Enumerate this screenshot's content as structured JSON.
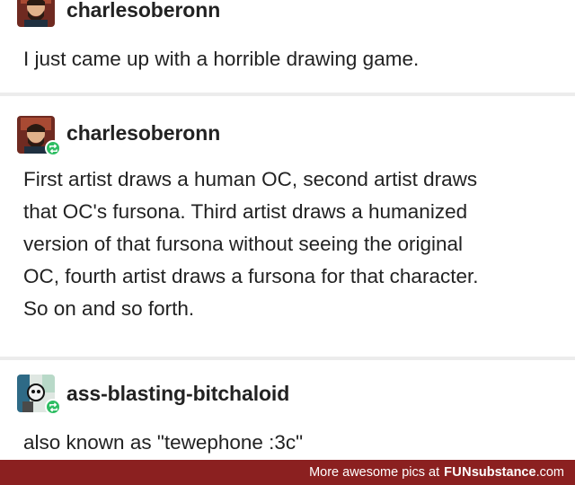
{
  "posts": [
    {
      "username": "charlesoberonn",
      "lines": [
        "I just came up with a horrible drawing game."
      ],
      "reblog": false
    },
    {
      "username": "charlesoberonn",
      "lines": [
        "First artist draws a human OC, second artist draws",
        "that OC's fursona. Third artist draws a humanized",
        "version of that fursona without seeing the original",
        "OC, fourth artist draws a fursona for that character.",
        "So on and so forth."
      ],
      "reblog": true
    },
    {
      "username": "ass-blasting-bitchaloid",
      "lines": [
        "also known as \"tewephone :3c\""
      ],
      "reblog": true
    }
  ],
  "footer": {
    "text": "More awesome pics at",
    "brand_fun": "FUN",
    "brand_substance": "substance",
    "brand_tld": ".com"
  },
  "colors": {
    "reblog_green": "#2dbd62",
    "footer_bg": "#8b2020",
    "avatar_red": "#8a2b22"
  }
}
